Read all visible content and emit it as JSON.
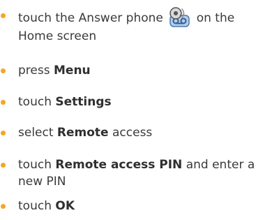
{
  "accent_color": "#f5a623",
  "steps": [
    {
      "parts": [
        "touch the Answer phone",
        "on the",
        "Home screen"
      ],
      "icon": "answer-phone-icon"
    },
    {
      "parts": [
        "press",
        "Menu"
      ]
    },
    {
      "parts": [
        "touch",
        "Settings"
      ]
    },
    {
      "parts": [
        "select",
        "Remote",
        "access"
      ]
    },
    {
      "parts": [
        "touch",
        "Remote access PIN",
        "and enter a",
        "new PIN"
      ]
    },
    {
      "parts": [
        "touch",
        "OK"
      ]
    }
  ]
}
